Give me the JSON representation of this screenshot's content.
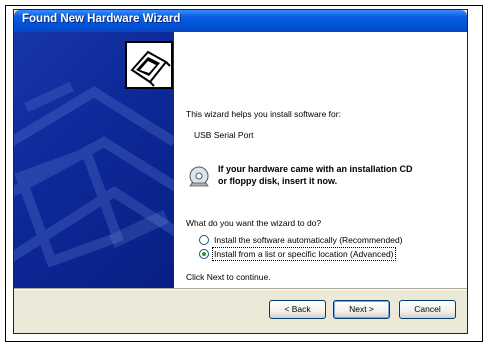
{
  "window": {
    "title": "Found New Hardware Wizard"
  },
  "intro": {
    "line1": "This wizard helps you install software for:",
    "device": "USB Serial Port"
  },
  "cd_notice": {
    "line1": "If your hardware came with an installation CD",
    "line2": "or floppy disk, insert it now."
  },
  "question": "What do you want the wizard to do?",
  "options": [
    {
      "label": "Install the software automatically (Recommended)",
      "selected": false
    },
    {
      "label": "Install from a list or specific location (Advanced)",
      "selected": true
    }
  ],
  "footer_hint": "Click Next to continue.",
  "buttons": {
    "back": "< Back",
    "next": "Next >",
    "cancel": "Cancel"
  },
  "colors": {
    "title_bar": "#0053d6",
    "side_panel": "#0d2a9a",
    "face": "#ece9d8"
  },
  "icons": {
    "wizard": "hardware-card-icon",
    "cd": "cd-icon"
  }
}
